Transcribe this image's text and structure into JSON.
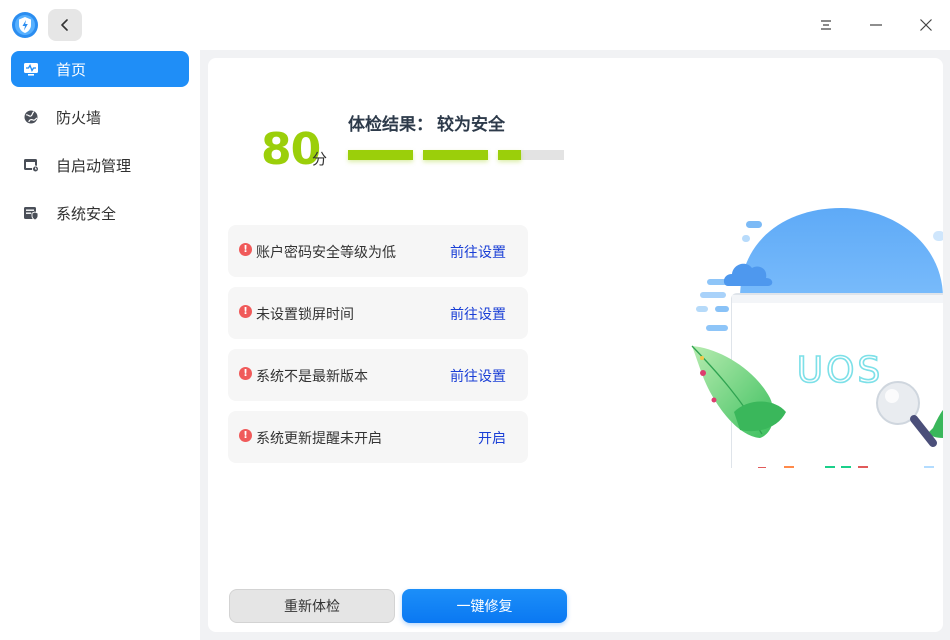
{
  "titlebar": {
    "back_icon": "chevron-left-icon",
    "menu_icon": "menu-icon",
    "minimize_icon": "minimize-icon",
    "close_icon": "close-icon"
  },
  "sidebar": {
    "items": [
      {
        "label": "首页",
        "icon": "monitor-pulse-icon",
        "active": true
      },
      {
        "label": "防火墙",
        "icon": "firewall-globe-icon",
        "active": false
      },
      {
        "label": "自启动管理",
        "icon": "startup-window-icon",
        "active": false
      },
      {
        "label": "系统安全",
        "icon": "system-shield-icon",
        "active": false
      }
    ]
  },
  "summary": {
    "score": "80",
    "score_unit": "分",
    "result_label": "体检结果：",
    "result_value": "较为安全",
    "progress": 0.8
  },
  "issues": [
    {
      "text": "账户密码安全等级为低",
      "action": "前往设置"
    },
    {
      "text": "未设置锁屏时间",
      "action": "前往设置"
    },
    {
      "text": "系统不是最新版本",
      "action": "前往设置"
    },
    {
      "text": "系统更新提醒未开启",
      "action": "开启"
    }
  ],
  "buttons": {
    "recheck": "重新体检",
    "fix_all": "一键修复"
  },
  "illustration": {
    "text": "UOS"
  },
  "colors": {
    "accent": "#1f8ef7",
    "score": "#9bcf0a",
    "warning": "#f05a5a",
    "link": "#1a3fd6"
  }
}
